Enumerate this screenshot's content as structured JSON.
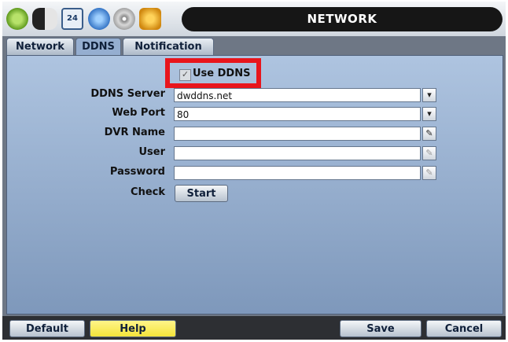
{
  "window": {
    "title": "NETWORK"
  },
  "toolbar_icons": [
    "gear-icon",
    "toggle-icon",
    "calendar-icon",
    "globe-icon",
    "disc-icon",
    "tools-icon"
  ],
  "calendar_day": "24",
  "tabs": [
    {
      "label": "Network"
    },
    {
      "label": "DDNS"
    },
    {
      "label": "Notification"
    }
  ],
  "active_tab": "DDNS",
  "use_ddns": {
    "label": "Use DDNS",
    "checked": true
  },
  "fields": {
    "ddns_server": {
      "label": "DDNS Server",
      "value": "dwddns.net"
    },
    "web_port": {
      "label": "Web Port",
      "value": "80"
    },
    "dvr_name": {
      "label": "DVR Name",
      "value": ""
    },
    "user": {
      "label": "User",
      "value": ""
    },
    "password": {
      "label": "Password",
      "value": ""
    },
    "check": {
      "label": "Check",
      "button_label": "Start"
    }
  },
  "footer": {
    "default_label": "Default",
    "help_label": "Help",
    "save_label": "Save",
    "cancel_label": "Cancel"
  },
  "colors": {
    "highlight": "#e8151c",
    "help_button": "#f4e43a",
    "title_bar": "#161616"
  }
}
